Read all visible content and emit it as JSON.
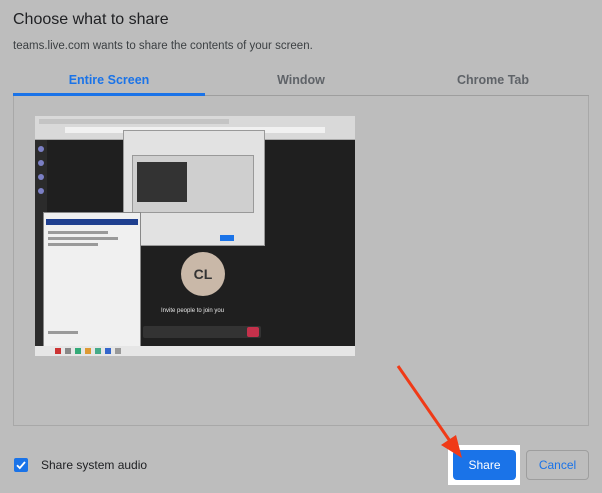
{
  "dialog": {
    "title": "Choose what to share",
    "subtitle": "teams.live.com wants to share the contents of your screen."
  },
  "tabs": [
    {
      "label": "Entire Screen",
      "active": true
    },
    {
      "label": "Window",
      "active": false
    },
    {
      "label": "Chrome Tab",
      "active": false
    }
  ],
  "preview": {
    "avatar_initials": "CL",
    "invite_text": "Invite people to join you"
  },
  "audio": {
    "label": "Share system audio",
    "checked": true
  },
  "buttons": {
    "share": "Share",
    "cancel": "Cancel"
  },
  "colors": {
    "accent": "#1a73e8",
    "annotation_arrow": "#f03a17",
    "background": "#bdbdbd"
  }
}
